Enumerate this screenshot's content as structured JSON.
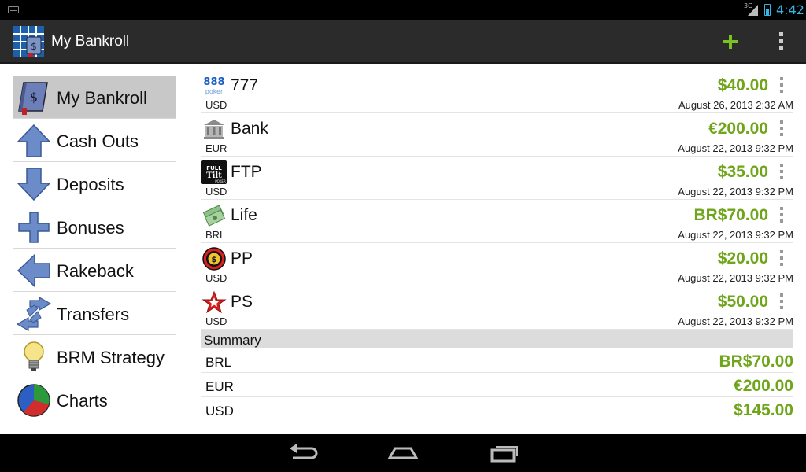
{
  "status_bar": {
    "network": "3G",
    "time": "4:42"
  },
  "app": {
    "title": "My Bankroll"
  },
  "action_bar": {
    "add_icon": "plus-icon",
    "overflow_icon": "overflow-menu-icon"
  },
  "sidebar": {
    "items": [
      {
        "label": "My Bankroll",
        "icon": "bankroll-book-icon",
        "active": true
      },
      {
        "label": "Cash Outs",
        "icon": "arrow-up-icon"
      },
      {
        "label": "Deposits",
        "icon": "arrow-down-icon"
      },
      {
        "label": "Bonuses",
        "icon": "plus-icon"
      },
      {
        "label": "Rakeback",
        "icon": "arrow-left-icon"
      },
      {
        "label": "Transfers",
        "icon": "transfer-arrows-icon"
      },
      {
        "label": "BRM Strategy",
        "icon": "lightbulb-icon"
      },
      {
        "label": "Charts",
        "icon": "pie-chart-icon"
      }
    ]
  },
  "accounts": [
    {
      "name": "777",
      "currency": "USD",
      "amount": "$40.00",
      "date": "August 26, 2013 2:32 AM",
      "icon": "888-poker-icon"
    },
    {
      "name": "Bank",
      "currency": "EUR",
      "amount": "€200.00",
      "date": "August 22, 2013 9:32 PM",
      "icon": "bank-icon"
    },
    {
      "name": "FTP",
      "currency": "USD",
      "amount": "$35.00",
      "date": "August 22, 2013 9:32 PM",
      "icon": "full-tilt-icon"
    },
    {
      "name": "Life",
      "currency": "BRL",
      "amount": "BR$70.00",
      "date": "August 22, 2013 9:32 PM",
      "icon": "money-icon"
    },
    {
      "name": "PP",
      "currency": "USD",
      "amount": "$20.00",
      "date": "August 22, 2013 9:32 PM",
      "icon": "party-poker-icon"
    },
    {
      "name": "PS",
      "currency": "USD",
      "amount": "$50.00",
      "date": "August 22, 2013 9:32 PM",
      "icon": "poker-stars-icon"
    }
  ],
  "summary": {
    "title": "Summary",
    "rows": [
      {
        "currency": "BRL",
        "amount": "BR$70.00"
      },
      {
        "currency": "EUR",
        "amount": "€200.00"
      },
      {
        "currency": "USD",
        "amount": "$145.00"
      }
    ]
  },
  "colors": {
    "amount_green": "#6fa519",
    "status_blue": "#33b5e5",
    "action_bar": "#2b2b2b"
  }
}
